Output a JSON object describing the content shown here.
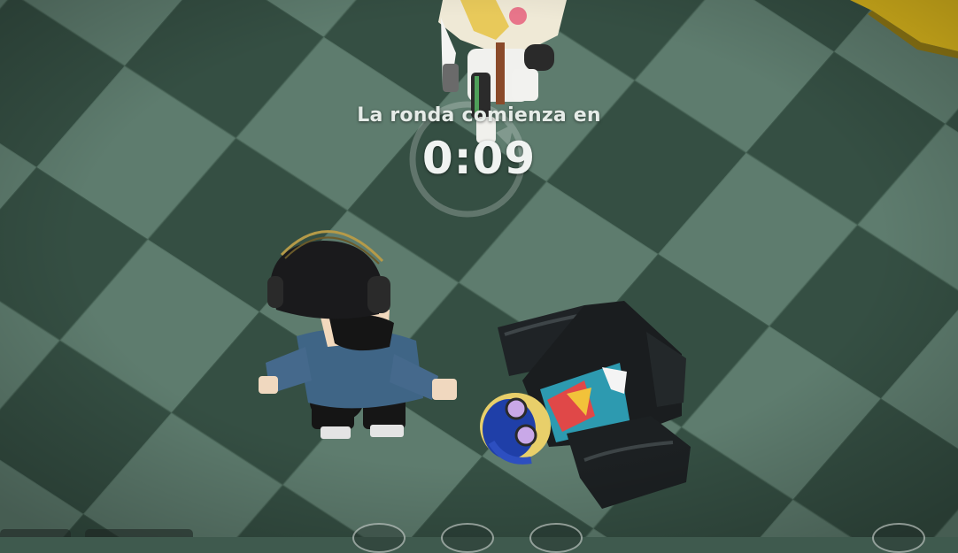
{
  "hud": {
    "round_label": "La ronda comienza en",
    "round_timer": "0:09"
  },
  "colors": {
    "floor_dark": "#355245",
    "floor_light": "#5c7a6c",
    "wall_yellow": "#d9b51c",
    "hud_text": "#e6ece8"
  },
  "icons": [
    "round-timer-ring-icon"
  ]
}
